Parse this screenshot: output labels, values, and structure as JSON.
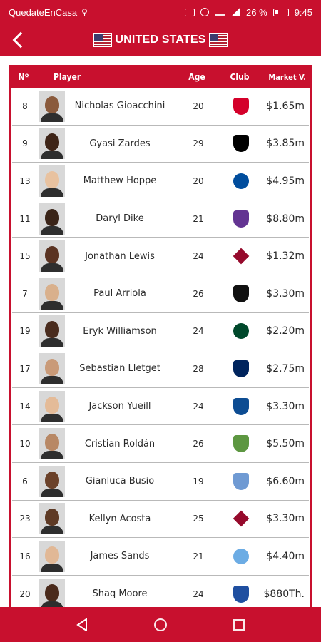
{
  "status_bar": {
    "carrier": "QuedateEnCasa",
    "battery": "26 %",
    "time": "9:45"
  },
  "header": {
    "title": "UNITED STATES",
    "back_icon": "chevron-left-icon",
    "flag_icon": "usa-flag-icon"
  },
  "table": {
    "columns": {
      "no": "Nº",
      "player": "Player",
      "age": "Age",
      "club": "Club",
      "market": "Market V."
    },
    "rows": [
      {
        "no": "8",
        "name": "Nicholas Gioacchini",
        "age": "20",
        "value": "$1.65m",
        "club_icon": "caen-icon",
        "skin": "#8a5a3c",
        "club_color": "#d4002a"
      },
      {
        "no": "9",
        "name": "Gyasi Zardes",
        "age": "29",
        "value": "$3.85m",
        "club_icon": "columbus-icon",
        "skin": "#3e2417",
        "club_color": "#000000"
      },
      {
        "no": "13",
        "name": "Matthew Hoppe",
        "age": "20",
        "value": "$4.95m",
        "club_icon": "schalke-icon",
        "skin": "#e8c2a0",
        "club_color": "#004d9d"
      },
      {
        "no": "11",
        "name": "Daryl Dike",
        "age": "21",
        "value": "$8.80m",
        "club_icon": "orlando-icon",
        "skin": "#3a2418",
        "club_color": "#633492"
      },
      {
        "no": "15",
        "name": "Jonathan Lewis",
        "age": "24",
        "value": "$1.32m",
        "club_icon": "colorado-icon",
        "skin": "#5a3322",
        "club_color": "#960a2c"
      },
      {
        "no": "7",
        "name": "Paul Arriola",
        "age": "26",
        "value": "$3.30m",
        "club_icon": "dc-united-icon",
        "skin": "#d9b08c",
        "club_color": "#111111"
      },
      {
        "no": "19",
        "name": "Eryk Williamson",
        "age": "24",
        "value": "$2.20m",
        "club_icon": "portland-icon",
        "skin": "#4a2c1e",
        "club_color": "#00482b"
      },
      {
        "no": "17",
        "name": "Sebastian Lletget",
        "age": "28",
        "value": "$2.75m",
        "club_icon": "la-galaxy-icon",
        "skin": "#c99a78",
        "club_color": "#00245d"
      },
      {
        "no": "14",
        "name": "Jackson Yueill",
        "age": "24",
        "value": "$3.30m",
        "club_icon": "san-jose-icon",
        "skin": "#e4bb98",
        "club_color": "#0d4c92"
      },
      {
        "no": "10",
        "name": "Cristian Roldán",
        "age": "26",
        "value": "$5.50m",
        "club_icon": "seattle-icon",
        "skin": "#b88865",
        "club_color": "#5d9741"
      },
      {
        "no": "6",
        "name": "Gianluca Busio",
        "age": "19",
        "value": "$6.60m",
        "club_icon": "sporting-kc-icon",
        "skin": "#6b4129",
        "club_color": "#6f9ad3"
      },
      {
        "no": "23",
        "name": "Kellyn Acosta",
        "age": "25",
        "value": "$3.30m",
        "club_icon": "colorado-icon",
        "skin": "#5e3a25",
        "club_color": "#960a2c"
      },
      {
        "no": "16",
        "name": "James Sands",
        "age": "21",
        "value": "$4.40m",
        "club_icon": "nycfc-icon",
        "skin": "#e1b896",
        "club_color": "#6cace4"
      },
      {
        "no": "20",
        "name": "Shaq Moore",
        "age": "24",
        "value": "$880Th.",
        "club_icon": "tenerife-icon",
        "skin": "#4a2a1b",
        "club_color": "#1f4fa0"
      }
    ]
  },
  "colors": {
    "accent": "#c8102e"
  }
}
